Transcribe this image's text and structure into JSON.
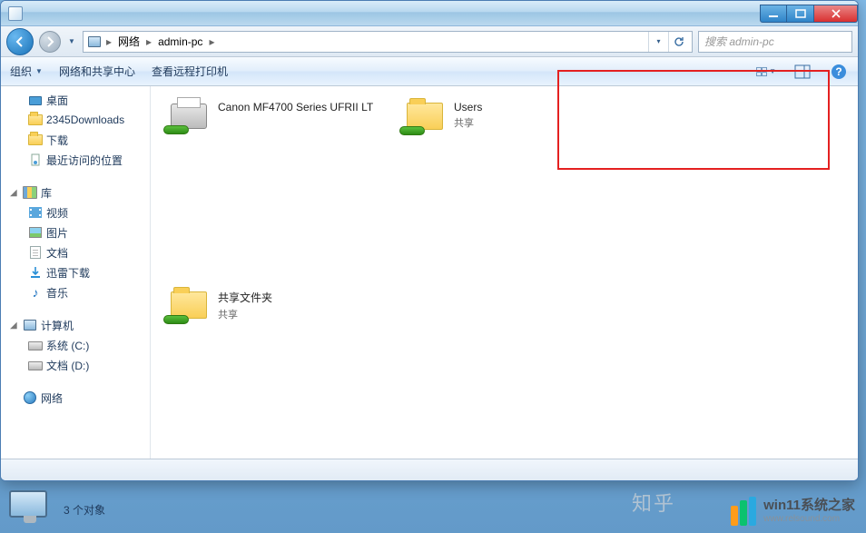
{
  "breadcrumb": {
    "seg1": "网络",
    "seg2": "admin-pc"
  },
  "search": {
    "placeholder": "搜索 admin-pc"
  },
  "toolbar": {
    "organize": "组织",
    "netcenter": "网络和共享中心",
    "remoteprinter": "查看远程打印机"
  },
  "sidebar": {
    "desktop": "桌面",
    "downloads2345": "2345Downloads",
    "downloads": "下载",
    "recent": "最近访问的位置",
    "lib": "库",
    "video": "视频",
    "pictures": "图片",
    "docs": "文档",
    "xunlei": "迅雷下载",
    "music": "音乐",
    "computer": "计算机",
    "cdrive": "系统 (C:)",
    "ddrive": "文档 (D:)",
    "network": "网络"
  },
  "content": {
    "items": [
      {
        "name": "Canon MF4700 Series UFRII LT",
        "sub": ""
      },
      {
        "name": "Users",
        "sub": "共享"
      },
      {
        "name": "共享文件夹",
        "sub": "共享"
      }
    ]
  },
  "footer": {
    "count": "3 个对象"
  },
  "watermark": {
    "zhihu": "知乎"
  },
  "brand": {
    "cn": "win11系统之家",
    "url": "www.relsound.com"
  }
}
